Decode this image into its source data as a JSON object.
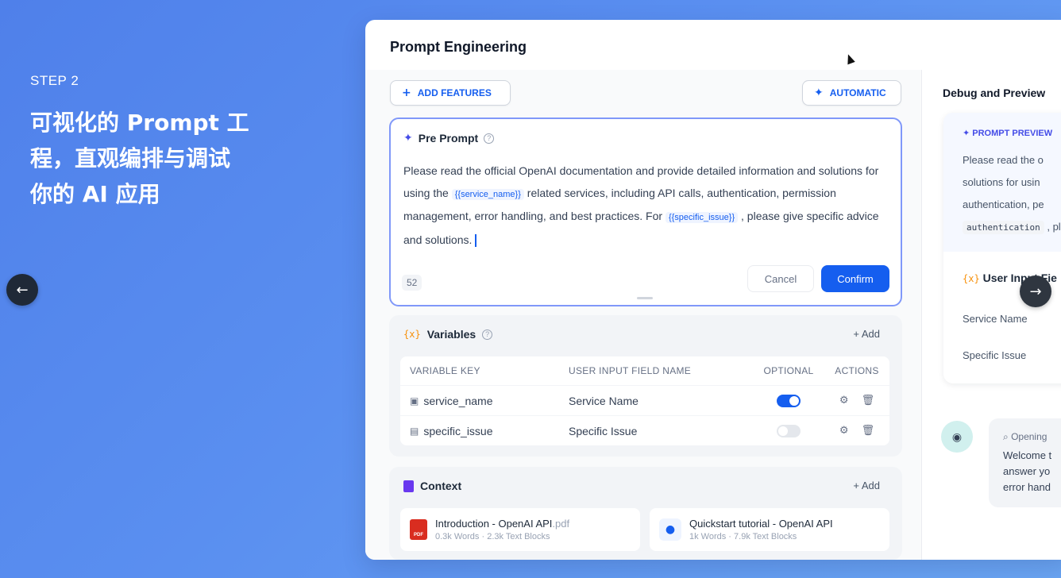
{
  "hero": {
    "step": "STEP 2",
    "lines": [
      "可视化的 Prompt 工",
      "程，直观编排与调试",
      "你的 AI 应用"
    ]
  },
  "nav": {
    "prev_icon": "arrow-left-icon",
    "next_icon": "arrow-right-icon"
  },
  "window": {
    "title": "Prompt Engineering"
  },
  "toolbar": {
    "add_features": "ADD FEATURES",
    "automatic": "AUTOMATIC"
  },
  "pre_prompt": {
    "title": "Pre Prompt",
    "text_1": "Please read the official OpenAI documentation and provide detailed information and solutions for using the",
    "var_1": "{{service_name}}",
    "text_2": "related services, including API calls, authentication, permission management, error handling, and best practices. For",
    "var_2": "{{specific_issue}}",
    "text_3": ", please give specific advice and solutions.",
    "char_count": "52",
    "cancel": "Cancel",
    "confirm": "Confirm"
  },
  "variables": {
    "title": "Variables",
    "add": "+ Add",
    "columns": [
      "VARIABLE KEY",
      "USER INPUT FIELD NAME",
      "OPTIONAL",
      "ACTIONS"
    ],
    "rows": [
      {
        "key": "service_name",
        "field": "Service Name",
        "optional": true
      },
      {
        "key": "specific_issue",
        "field": "Specific Issue",
        "optional": false
      }
    ]
  },
  "context": {
    "title": "Context",
    "add": "+ Add",
    "items": [
      {
        "name": "Introduction - OpenAI API",
        "ext": ".pdf",
        "meta": "0.3k Words · 2.3k Text Blocks"
      },
      {
        "name": "Quickstart tutorial - OpenAI API",
        "ext": "",
        "meta": "1k Words · 7.9k Text Blocks"
      }
    ]
  },
  "debug": {
    "title": "Debug and Preview",
    "prompt_preview_label": "PROMPT PREVIEW",
    "preview_lines": [
      "Please read the o",
      "solutions for usin",
      "authentication, pe"
    ],
    "preview_chip": "authentication",
    "preview_chip_after": ", pl",
    "user_input_title": "User Input Fie",
    "fields": [
      "Service Name",
      "Specific Issue"
    ],
    "opening_label": "Opening",
    "opening_lines": [
      "Welcome t",
      "answer yo",
      "error hand"
    ]
  },
  "colors": {
    "accent": "#155eef",
    "background_start": "#4f80ea",
    "background_end": "#6ba6f4"
  }
}
